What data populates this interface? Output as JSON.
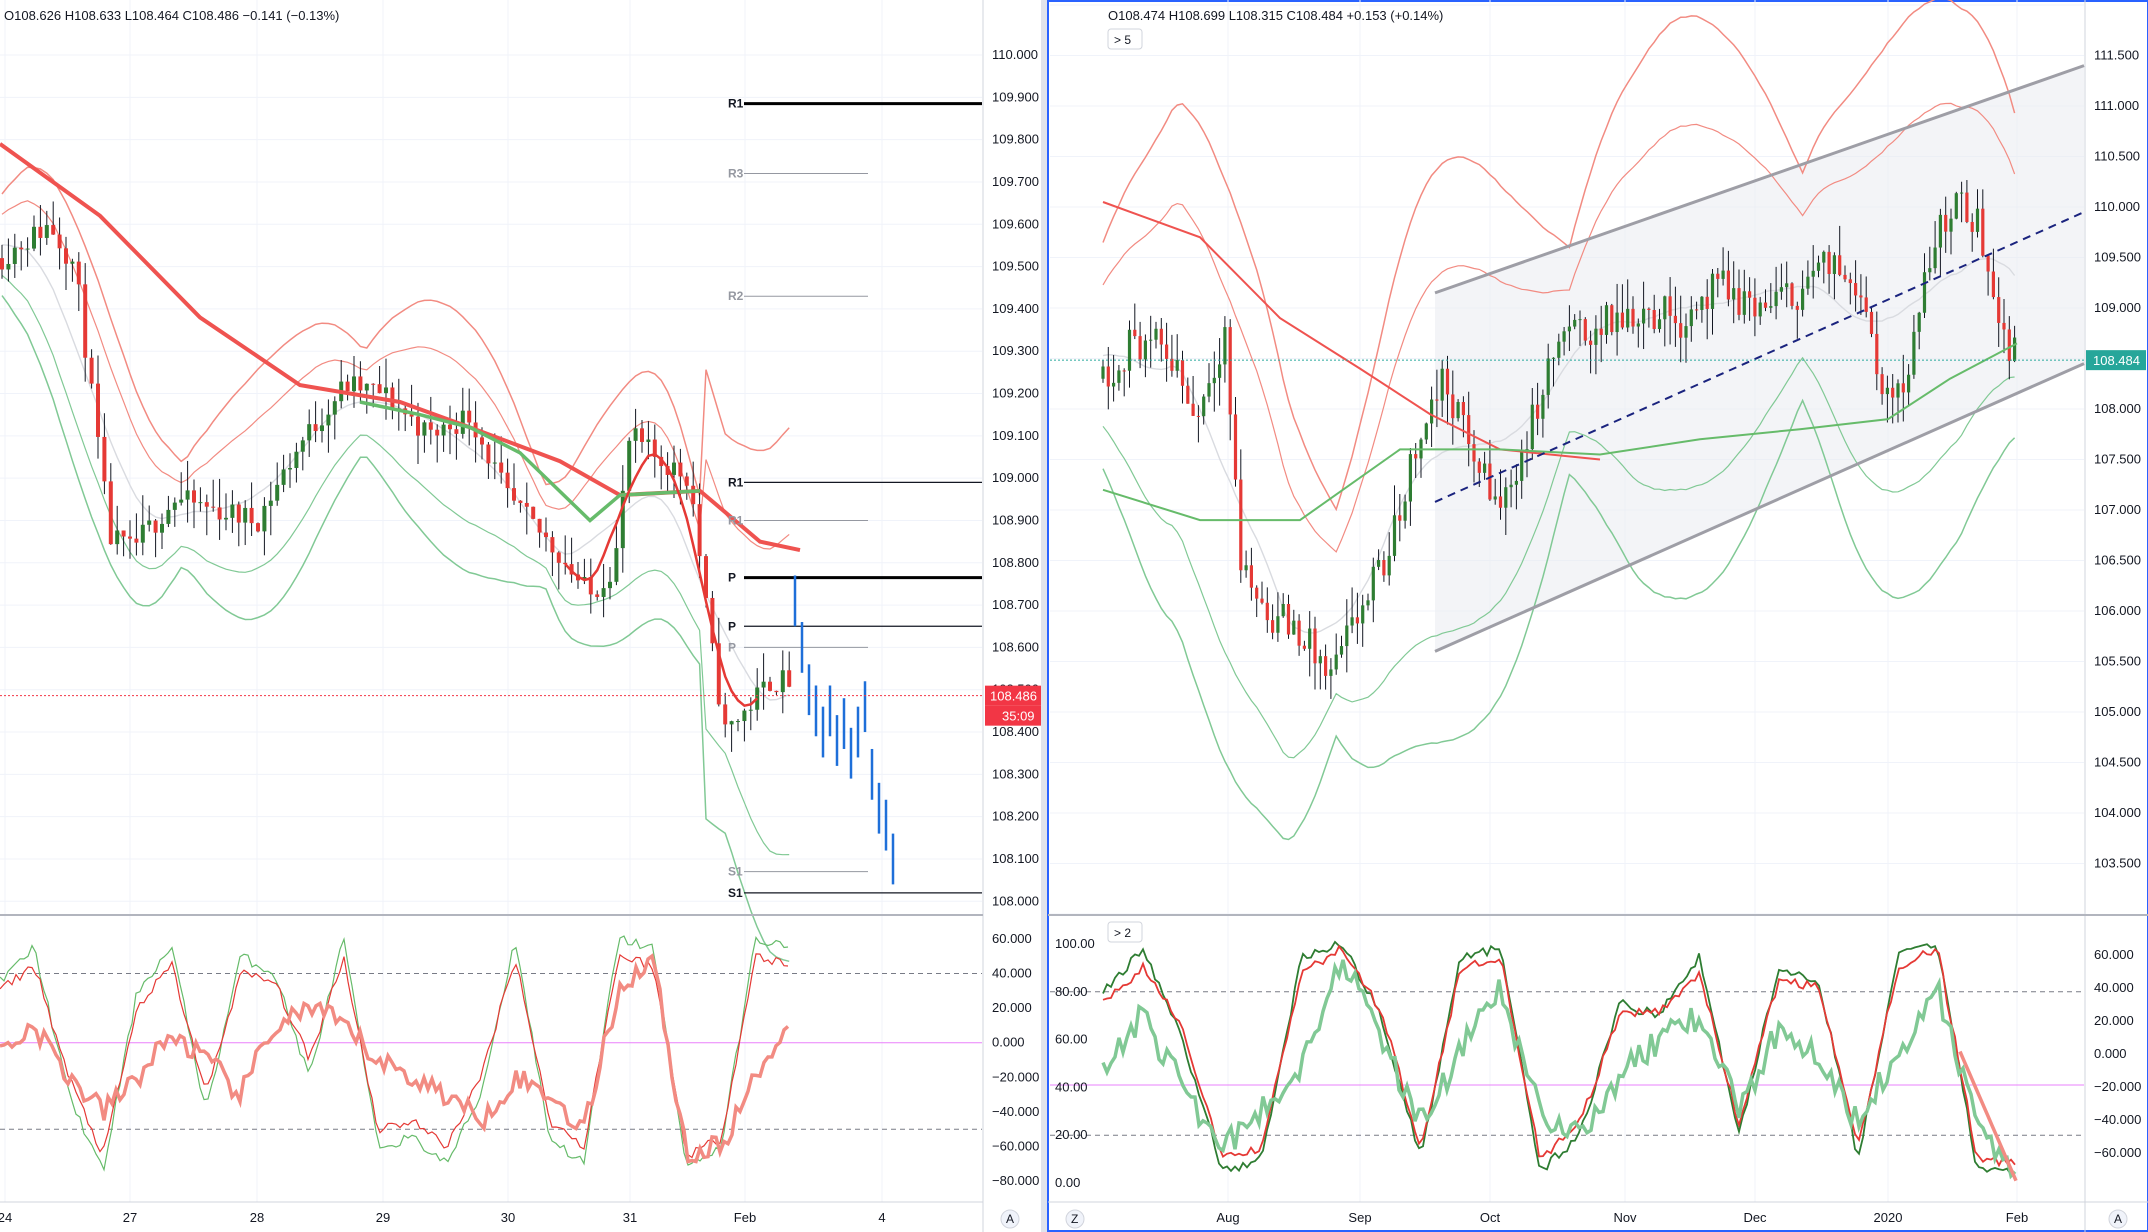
{
  "left": {
    "ohlc": "O108.626  H108.633  L108.464  C108.486  −0.141 (−0.13%)",
    "price_axis": [
      "110.000",
      "109.900",
      "109.800",
      "109.700",
      "109.600",
      "109.500",
      "109.400",
      "109.300",
      "109.200",
      "109.100",
      "109.000",
      "108.900",
      "108.800",
      "108.700",
      "108.600",
      "108.500",
      "108.400",
      "108.300",
      "108.200",
      "108.100",
      "108.000"
    ],
    "last_price": "108.486",
    "countdown": "35:09",
    "time_axis": [
      "24",
      "27",
      "28",
      "29",
      "30",
      "31",
      "Feb",
      "4"
    ],
    "osc_axis": [
      "60.000",
      "40.000",
      "20.000",
      "0.000",
      "−20.000",
      "−40.000",
      "−60.000",
      "−80.000"
    ],
    "pivots": [
      {
        "label": "R1",
        "price": 109.885,
        "style": "black-thick"
      },
      {
        "label": "R3",
        "price": 109.72,
        "style": "grey"
      },
      {
        "label": "R2",
        "price": 109.43,
        "style": "grey"
      },
      {
        "label": "R1",
        "price": 108.99,
        "style": "black"
      },
      {
        "label": "R1",
        "price": 108.9,
        "style": "grey"
      },
      {
        "label": "P",
        "price": 108.765,
        "style": "black-thick"
      },
      {
        "label": "P",
        "price": 108.65,
        "style": "black"
      },
      {
        "label": "P",
        "price": 108.6,
        "style": "grey"
      },
      {
        "label": "S1",
        "price": 108.07,
        "style": "grey"
      },
      {
        "label": "S1",
        "price": 108.02,
        "style": "black"
      }
    ],
    "corner_button": "A"
  },
  "right": {
    "ohlc": "O108.474  H108.699  L108.315  C108.484  +0.153 (+0.14%)",
    "indicator_toggle": "> 5",
    "price_axis": [
      "112.000",
      "111.500",
      "111.000",
      "110.500",
      "110.000",
      "109.500",
      "109.000",
      "108.500",
      "108.000",
      "107.500",
      "107.000",
      "106.500",
      "106.000",
      "105.500",
      "105.000",
      "104.500",
      "104.000",
      "103.500",
      "103.000"
    ],
    "last_price": "108.484",
    "time_axis": [
      "Aug",
      "Sep",
      "Oct",
      "Nov",
      "Dec",
      "2020",
      "Feb"
    ],
    "osc_toggle": "> 2",
    "osc_axis_left": [
      "100.00",
      "80.00",
      "60.00",
      "40.00",
      "20.00",
      "0.00"
    ],
    "osc_axis_right": [
      "60.000",
      "40.000",
      "20.000",
      "0.000",
      "−20.000",
      "−40.000",
      "−60.000"
    ],
    "corner_button_left": "Z",
    "corner_button_right": "A"
  },
  "colors": {
    "bull": "#26a69a",
    "bull_candle": "#2e7d32",
    "bear": "#e53935",
    "band_red": "#f28b82",
    "band_green": "#81c995",
    "ma_red": "#ef5350",
    "ma_green": "#66bb6a",
    "dots": "#1e6fd9",
    "channel": "#9e9ea6",
    "mid_line": "#1a237e",
    "last_left": "#f23645",
    "last_right": "#26a69a",
    "pane_border": "#2962ff"
  },
  "chart_data": [
    {
      "type": "candlestick",
      "pane": "left-price",
      "ylim": [
        107.97,
        110.13
      ],
      "x": [
        "24",
        "27",
        "28",
        "29",
        "30",
        "31",
        "Feb",
        "4"
      ],
      "series_shown": [
        "price candles",
        "bollinger bands",
        "moving averages",
        "pivot levels",
        "projection bars"
      ],
      "last_price": 108.486,
      "key_prices": [
        {
          "x": "24",
          "price": 109.57
        },
        {
          "x": "27",
          "price": 108.83
        },
        {
          "x": "28",
          "price": 108.93
        },
        {
          "x": "29",
          "price": 109.2
        },
        {
          "x": "30",
          "price": 108.95
        },
        {
          "x": "31",
          "price": 108.95
        },
        {
          "x": "Feb",
          "price": 108.45
        },
        {
          "x": "4",
          "price": 108.1
        }
      ]
    },
    {
      "type": "candlestick",
      "pane": "right-price",
      "ylim": [
        103.0,
        112.05
      ],
      "x": [
        "Aug",
        "Sep",
        "Oct",
        "Nov",
        "Dec",
        "2020",
        "Feb"
      ],
      "series_shown": [
        "price candles",
        "bollinger bands",
        "moving averages",
        "regression channel"
      ],
      "last_price": 108.484,
      "channel": {
        "upper": [
          109.15,
          111.4
        ],
        "mid": [
          107.08,
          109.95
        ],
        "lower": [
          105.6,
          108.45
        ]
      },
      "key_prices": [
        {
          "x": "Aug",
          "price": 108.7
        },
        {
          "x": "Sep",
          "price": 105.5
        },
        {
          "x": "Oct",
          "price": 107.0
        },
        {
          "x": "Nov",
          "price": 108.8
        },
        {
          "x": "Dec",
          "price": 109.4
        },
        {
          "x": "2020",
          "price": 108.0
        },
        {
          "x": "Feb",
          "price": 108.484
        }
      ]
    },
    {
      "type": "line",
      "pane": "left-oscillator",
      "ylim": [
        -88,
        68
      ],
      "levels": [
        40,
        -50
      ],
      "center": 0,
      "series": [
        {
          "name": "fast",
          "values": [
            35,
            55,
            -30,
            -75,
            30,
            55,
            -40,
            50,
            40,
            -20,
            60,
            -60,
            -55,
            -70,
            -30,
            60,
            -55,
            -70,
            60,
            55,
            -72,
            -60,
            60,
            55
          ]
        },
        {
          "name": "slow",
          "values": [
            30,
            45,
            -20,
            -65,
            20,
            45,
            -30,
            40,
            35,
            -10,
            50,
            -50,
            -45,
            -60,
            -20,
            50,
            -45,
            -60,
            50,
            45,
            -65,
            -55,
            50,
            45
          ]
        },
        {
          "name": "signal",
          "values": [
            -5,
            10,
            -20,
            -40,
            -20,
            5,
            -10,
            -30,
            10,
            20,
            10,
            -10,
            -20,
            -30,
            -45,
            -20,
            -30,
            -50,
            30,
            50,
            -65,
            -60,
            -20,
            15
          ]
        }
      ]
    },
    {
      "type": "line",
      "pane": "right-oscillator",
      "ylim": [
        -5,
        105
      ],
      "levels": [
        80,
        20
      ],
      "series": [
        {
          "name": "stoch-k",
          "values": [
            80,
            98,
            60,
            5,
            10,
            95,
            100,
            70,
            10,
            95,
            98,
            5,
            20,
            75,
            70,
            95,
            20,
            90,
            85,
            10,
            95,
            100,
            5,
            5
          ]
        },
        {
          "name": "stoch-d",
          "values": [
            75,
            90,
            65,
            10,
            15,
            88,
            98,
            72,
            15,
            90,
            95,
            10,
            25,
            70,
            72,
            88,
            25,
            85,
            82,
            15,
            90,
            98,
            10,
            8
          ]
        },
        {
          "name": "momentum",
          "values": [
            50,
            70,
            40,
            15,
            30,
            50,
            95,
            60,
            25,
            55,
            80,
            30,
            20,
            45,
            60,
            70,
            30,
            65,
            55,
            25,
            55,
            80,
            25,
            0
          ]
        }
      ]
    }
  ]
}
